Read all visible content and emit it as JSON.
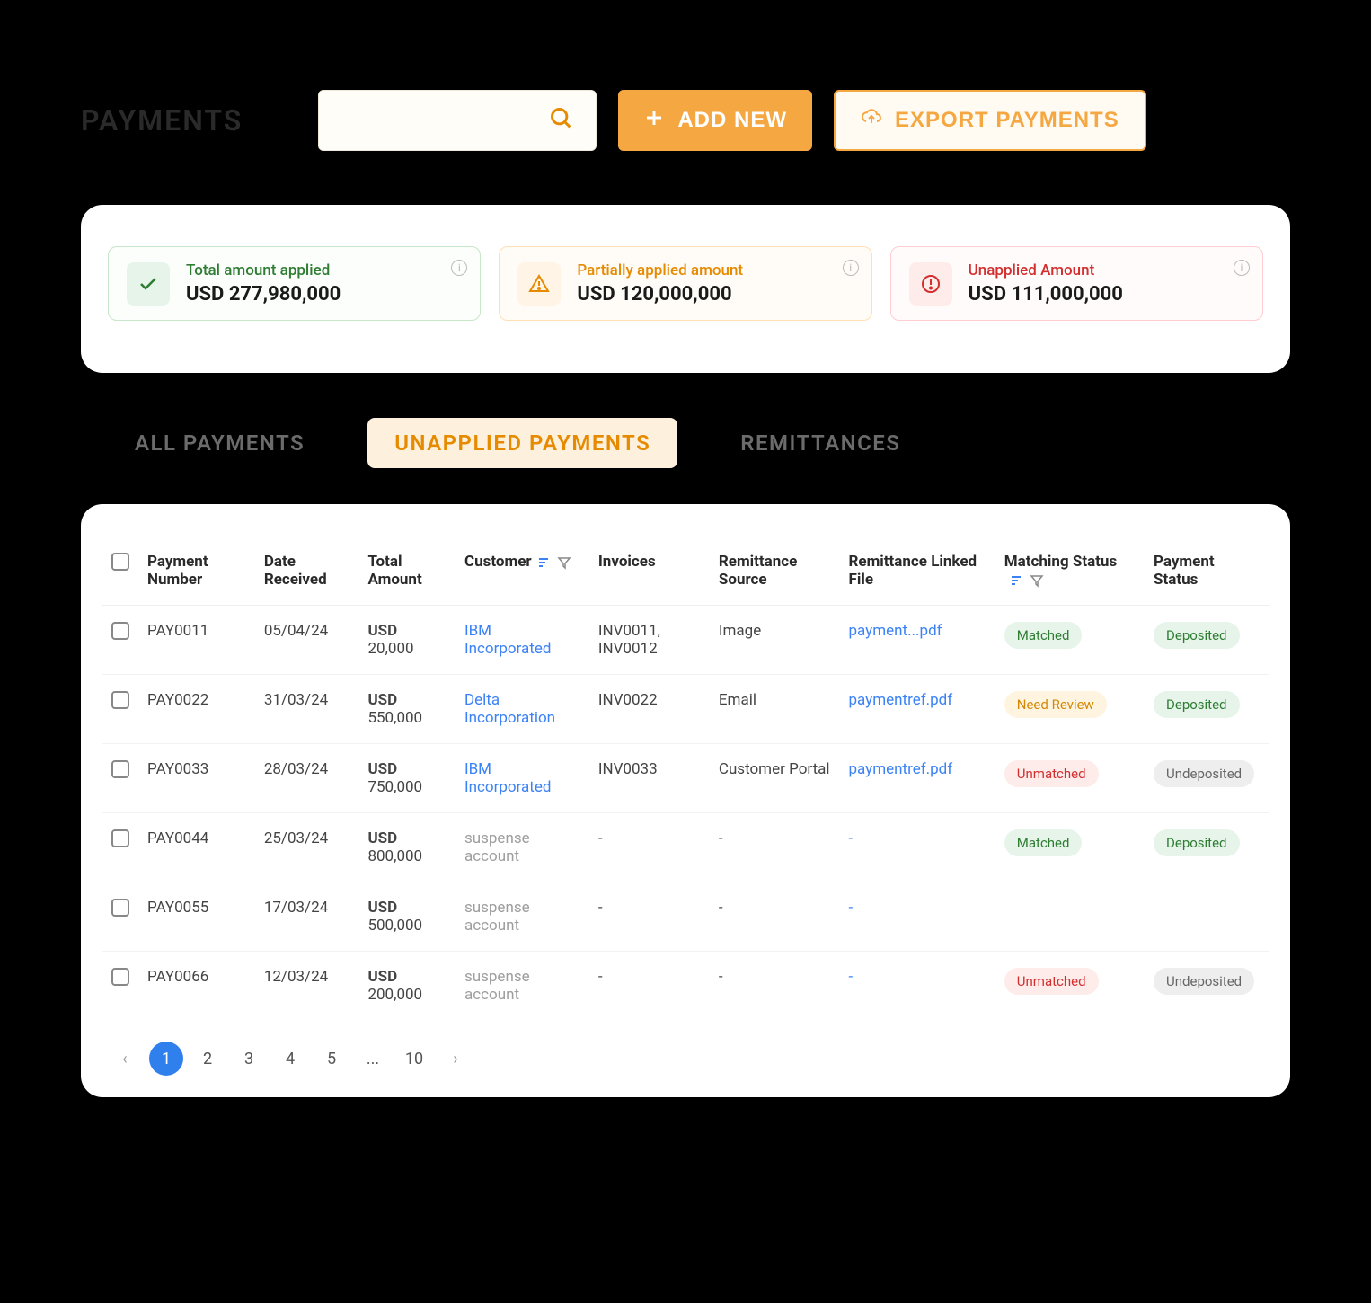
{
  "header": {
    "title": "PAYMENTS",
    "add_label": "ADD NEW",
    "export_label": "EXPORT PAYMENTS"
  },
  "stats": [
    {
      "label": "Total amount applied",
      "currency": "USD",
      "value": "277,980,000",
      "tone": "green"
    },
    {
      "label": "Partially applied amount",
      "currency": "USD",
      "value": "120,000,000",
      "tone": "orange"
    },
    {
      "label": "Unapplied Amount",
      "currency": "USD",
      "value": "111,000,000",
      "tone": "red"
    }
  ],
  "tabs": [
    {
      "label": "ALL PAYMENTS",
      "active": false
    },
    {
      "label": "UNAPPLIED PAYMENTS",
      "active": true
    },
    {
      "label": "REMITTANCES",
      "active": false
    }
  ],
  "columns": [
    "Payment Number",
    "Date Received",
    "Total Amount",
    "Customer",
    "Invoices",
    "Remittance Source",
    "Remittance Linked File",
    "Matching Status",
    "Payment Status"
  ],
  "rows": [
    {
      "payment_number": "PAY0011",
      "date_received": "05/04/24",
      "amount_currency": "USD",
      "amount_value": "20,000",
      "customer": "IBM Incorporated",
      "customer_link": true,
      "invoices": "INV0011, INV0012",
      "remittance_source": "Image",
      "remittance_file": "payment...pdf",
      "remittance_link": true,
      "matching_status": "Matched",
      "matching_tone": "matched",
      "payment_status": "Deposited",
      "payment_tone": "deposited"
    },
    {
      "payment_number": "PAY0022",
      "date_received": "31/03/24",
      "amount_currency": "USD",
      "amount_value": "550,000",
      "customer": "Delta Incorporation",
      "customer_link": true,
      "invoices": "INV0022",
      "remittance_source": "Email",
      "remittance_file": "paymentref.pdf",
      "remittance_link": true,
      "matching_status": "Need Review",
      "matching_tone": "review",
      "payment_status": "Deposited",
      "payment_tone": "deposited"
    },
    {
      "payment_number": "PAY0033",
      "date_received": "28/03/24",
      "amount_currency": "USD",
      "amount_value": "750,000",
      "customer": "IBM Incorporated",
      "customer_link": true,
      "invoices": "INV0033",
      "remittance_source": "Customer Portal",
      "remittance_file": "paymentref.pdf",
      "remittance_link": true,
      "matching_status": "Unmatched",
      "matching_tone": "unmatched",
      "payment_status": "Undeposited",
      "payment_tone": "undeposited"
    },
    {
      "payment_number": "PAY0044",
      "date_received": "25/03/24",
      "amount_currency": "USD",
      "amount_value": "800,000",
      "customer": "suspense account",
      "customer_link": false,
      "invoices": "-",
      "remittance_source": "-",
      "remittance_file": "-",
      "remittance_link": true,
      "matching_status": "Matched",
      "matching_tone": "matched",
      "payment_status": "Deposited",
      "payment_tone": "deposited"
    },
    {
      "payment_number": "PAY0055",
      "date_received": "17/03/24",
      "amount_currency": "USD",
      "amount_value": "500,000",
      "customer": "suspense account",
      "customer_link": false,
      "invoices": "-",
      "remittance_source": "-",
      "remittance_file": "-",
      "remittance_link": true,
      "matching_status": "",
      "matching_tone": "",
      "payment_status": "",
      "payment_tone": ""
    },
    {
      "payment_number": "PAY0066",
      "date_received": "12/03/24",
      "amount_currency": "USD",
      "amount_value": "200,000",
      "customer": "suspense account",
      "customer_link": false,
      "invoices": "-",
      "remittance_source": "-",
      "remittance_file": "-",
      "remittance_link": true,
      "matching_status": "Unmatched",
      "matching_tone": "unmatched",
      "payment_status": "Undeposited",
      "payment_tone": "undeposited"
    }
  ],
  "pagination": {
    "pages": [
      "1",
      "2",
      "3",
      "4",
      "5",
      "...",
      "10"
    ],
    "active": "1"
  }
}
